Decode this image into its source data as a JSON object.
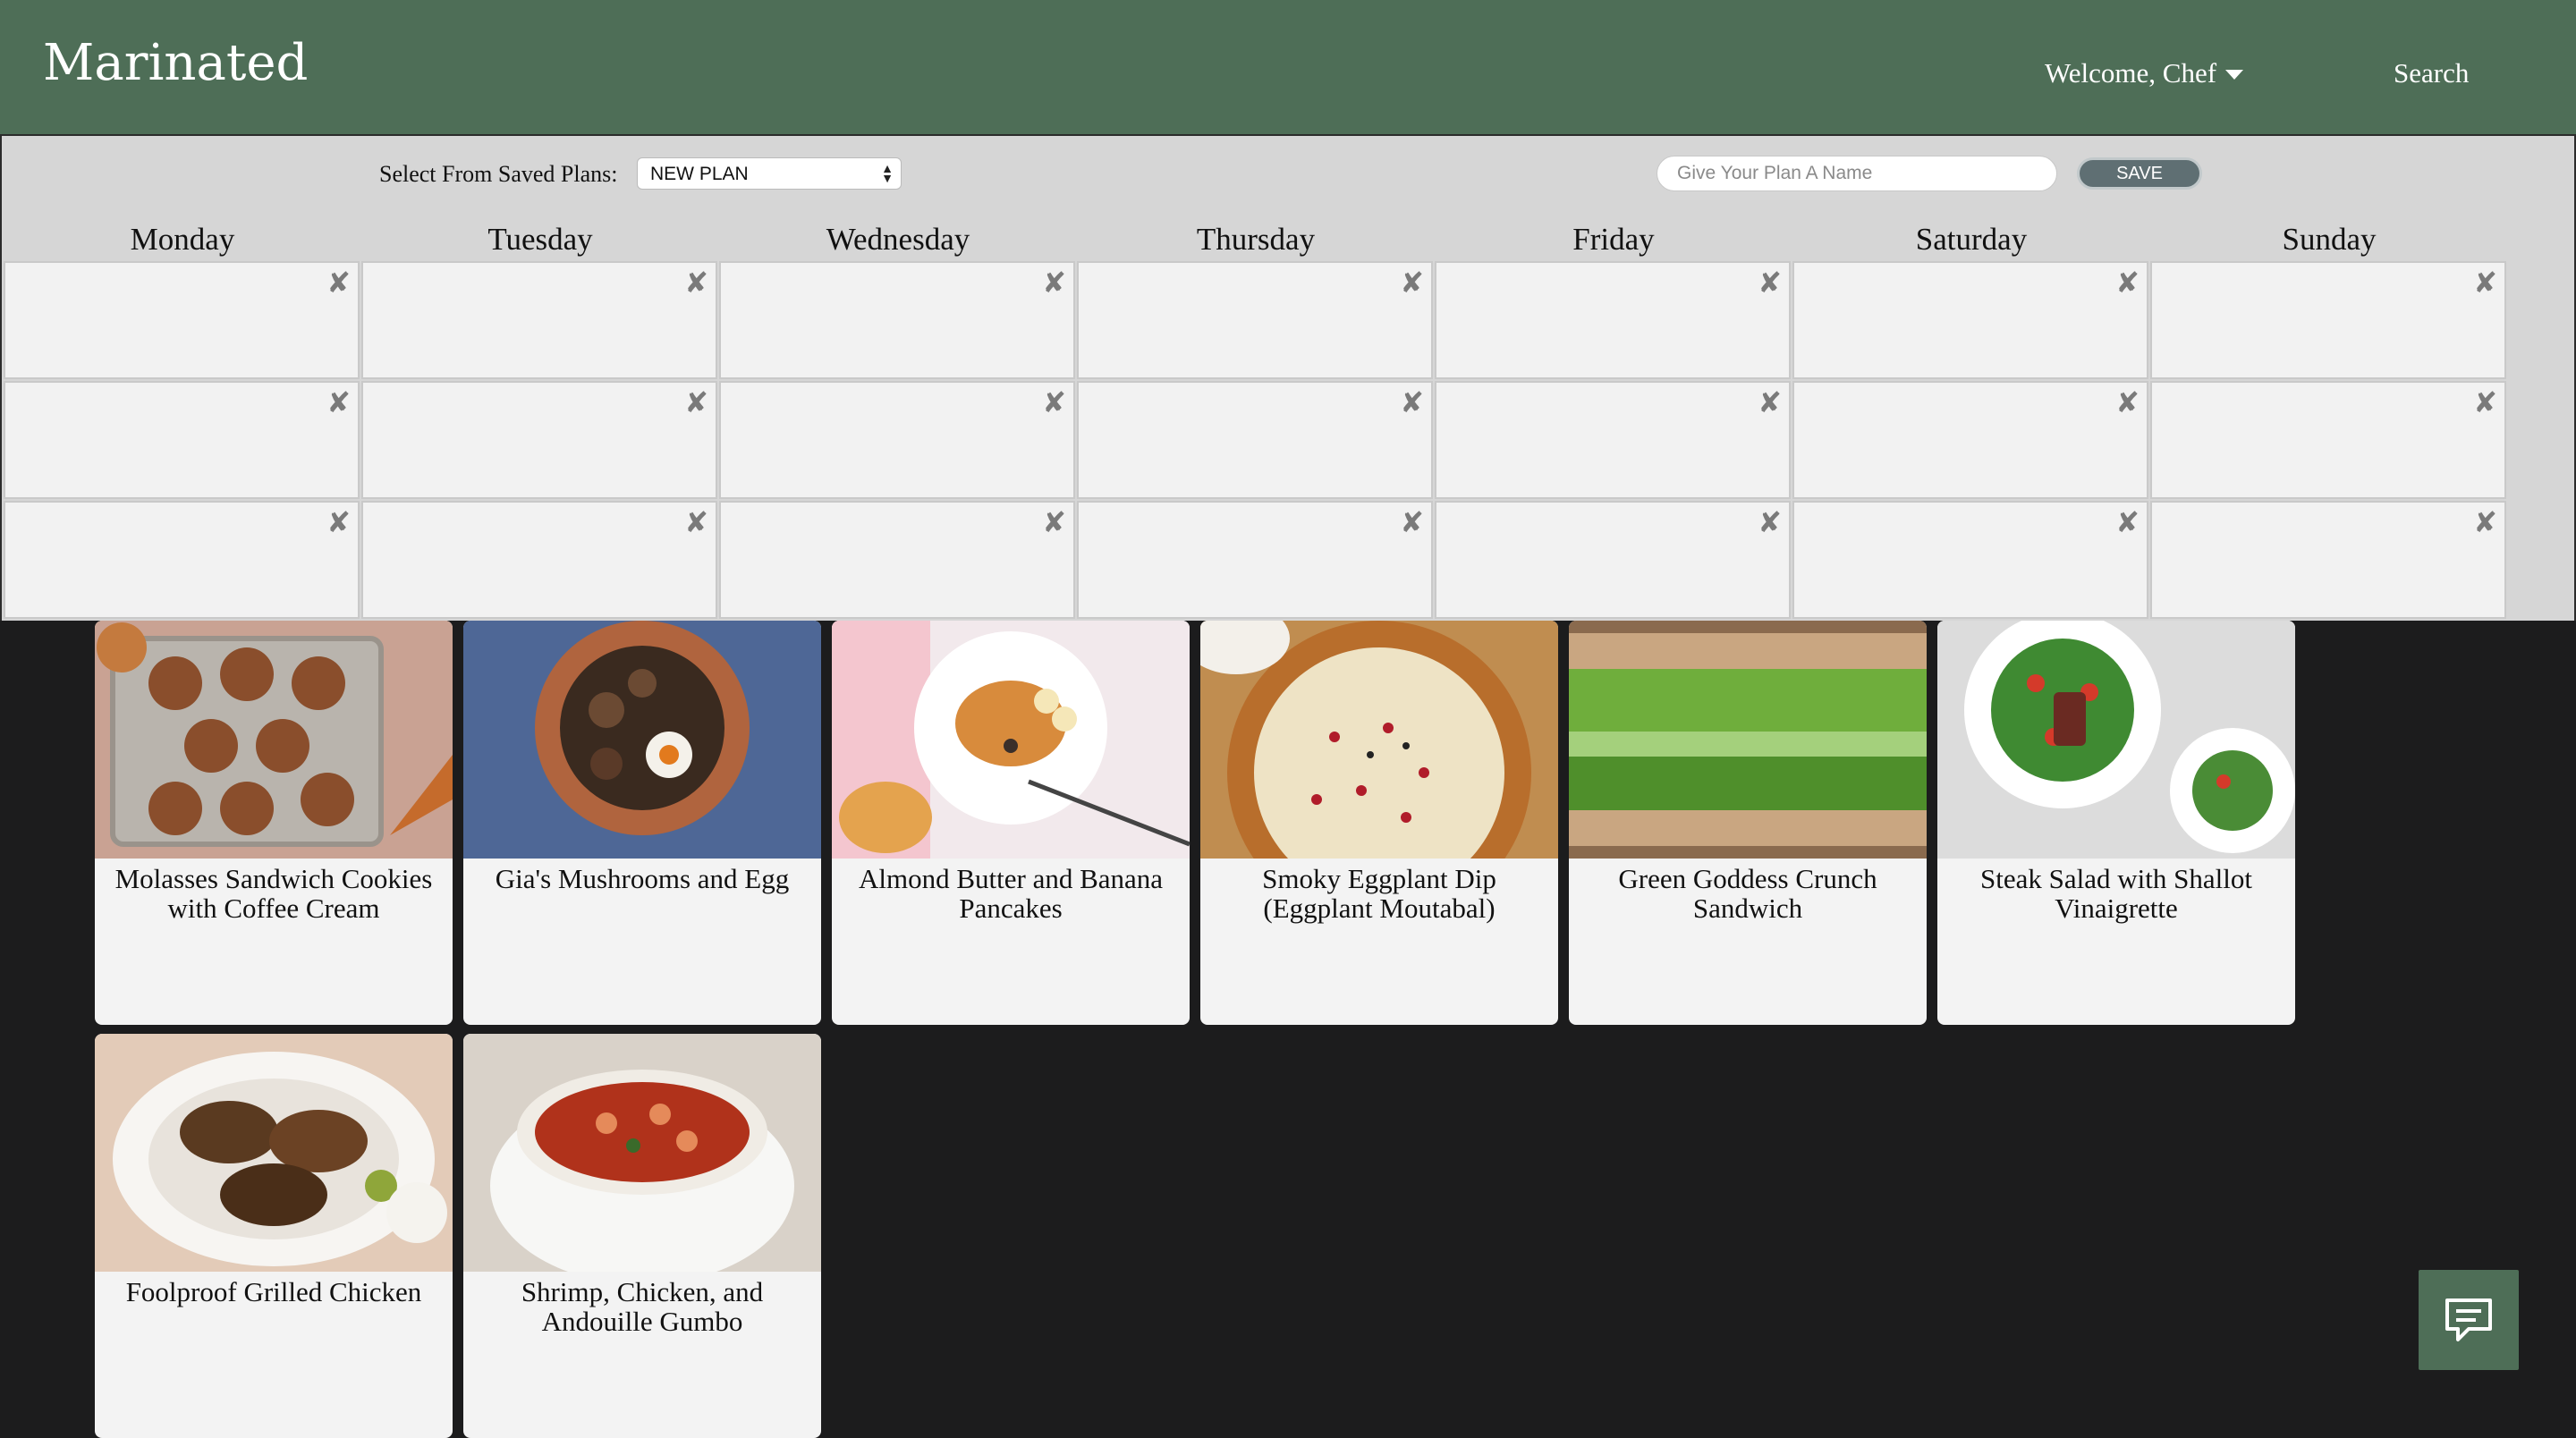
{
  "header": {
    "brand": "Marinated",
    "welcome": "Welcome, Chef",
    "search": "Search"
  },
  "planner": {
    "saved_label": "Select From Saved Plans:",
    "selected_plan": "NEW PLAN",
    "name_placeholder": "Give Your Plan A Name",
    "save_label": "SAVE",
    "days": [
      "Monday",
      "Tuesday",
      "Wednesday",
      "Thursday",
      "Friday",
      "Saturday",
      "Sunday"
    ],
    "remove_glyph": "✘"
  },
  "recipes": [
    {
      "title": "Molasses Sandwich Cookies with Coffee Cream"
    },
    {
      "title": "Gia's Mushrooms and Egg"
    },
    {
      "title": "Almond Butter and Banana Pancakes"
    },
    {
      "title": "Smoky Eggplant Dip (Eggplant Moutabal)"
    },
    {
      "title": "Green Goddess Crunch Sandwich"
    },
    {
      "title": "Steak Salad with Shallot Vinaigrette"
    },
    {
      "title": "Foolproof Grilled Chicken"
    },
    {
      "title": "Shrimp, Chicken, and Andouille Gumbo"
    }
  ],
  "colors": {
    "header_bg": "#4e6e57",
    "planner_bg": "#d6d6d6",
    "page_bg": "#1c1c1d",
    "save_button": "#5f6f73"
  },
  "icons": {
    "user_menu": "chevron-down-icon",
    "remove": "close-icon",
    "chat": "chat-icon"
  }
}
